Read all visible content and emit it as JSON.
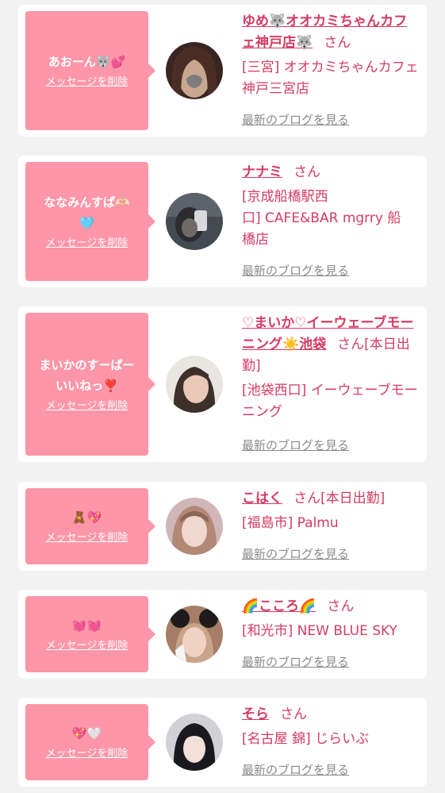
{
  "delete_label": "メッセージを削除",
  "blog_label": "最新のブログを見る",
  "colors": {
    "accent": "#d53b63",
    "bubble": "#fc96a8",
    "card": "#ffffff",
    "background": "#f2f2f2"
  },
  "cards": [
    {
      "message": "あおーん🐺💕",
      "name": "ゆめ🐺オオカミちゃんカフェ神戸店🐺",
      "san": "さん",
      "status": "",
      "shop": "[三宮] オオカミちゃんカフェ神戸三宮店",
      "avatar_palette": [
        "#3a2621",
        "#c8a690",
        "#7d5a4a"
      ]
    },
    {
      "message": "ななみんすぱ🫶🏻\n🩵",
      "name": "ナナミ",
      "san": "さん",
      "status": "",
      "shop": "[京成船橋駅西\n口] CAFE&BAR mgrry 船\n橋店",
      "avatar_palette": [
        "#444a52",
        "#6f6a66",
        "#2c2c30"
      ]
    },
    {
      "message": "まいかのすーぱー\nいいねっ❣️",
      "name": "♡まいか♡イーウェーブモーニング☀️池袋",
      "san": "さん",
      "status": "[本日出勤]",
      "shop": "[池袋西口] イーウェーブモーニング",
      "avatar_palette": [
        "#e9e6e2",
        "#3d2f2a",
        "#e8c8b6"
      ]
    },
    {
      "message": "🧸💖",
      "name": "こはく",
      "san": "さん",
      "status": "[本日出勤]",
      "shop": "[福島市] Palmu",
      "avatar_palette": [
        "#d0b6b8",
        "#b28877",
        "#f0d8d0"
      ]
    },
    {
      "message": "💓💓",
      "name": "🌈こころ🌈",
      "san": "さん",
      "status": "",
      "shop": "[和光市] NEW BLUE SKY",
      "avatar_palette": [
        "#a67d66",
        "#1d1b1c",
        "#efd2c2"
      ]
    },
    {
      "message": "💖🤍",
      "name": "そら",
      "san": "さん",
      "status": "",
      "shop": "[名古屋 錦] じらいぶ",
      "avatar_palette": [
        "#d2d2d6",
        "#1a1a1e",
        "#f1dfd8"
      ]
    }
  ]
}
